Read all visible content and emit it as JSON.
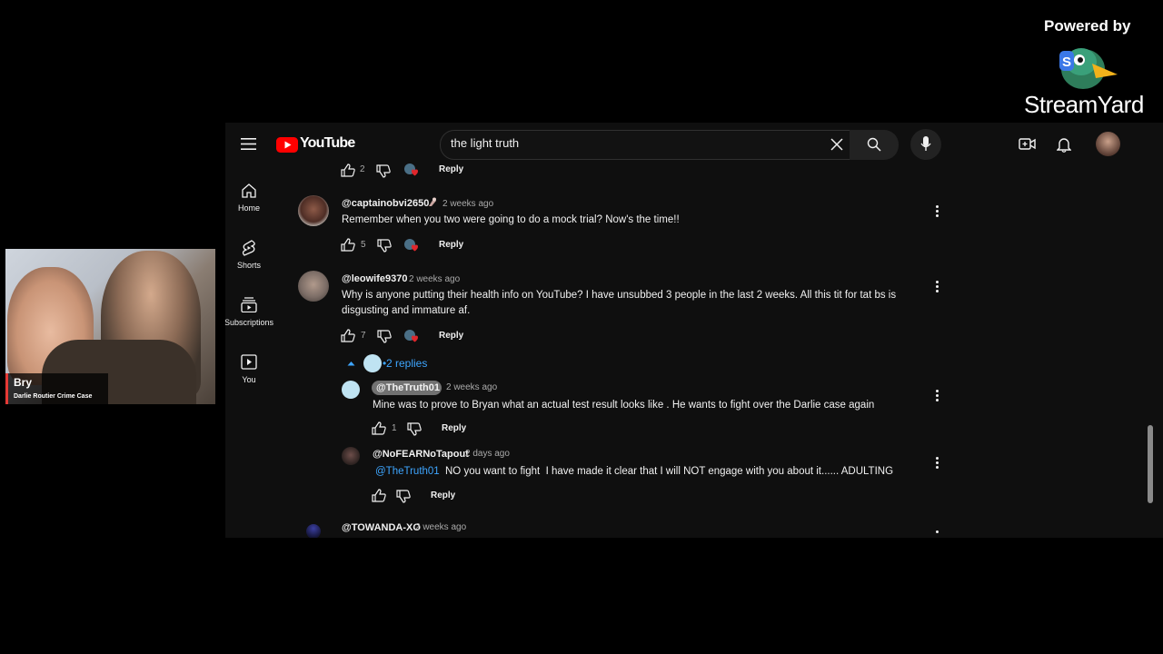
{
  "youtube": {
    "logo_text": "YouTube",
    "search_value": "the light truth",
    "sidebar": [
      {
        "label": "Home",
        "icon": "home-icon"
      },
      {
        "label": "Shorts",
        "icon": "shorts-icon"
      },
      {
        "label": "Subscriptions",
        "icon": "subscriptions-icon"
      },
      {
        "label": "You",
        "icon": "you-icon"
      }
    ],
    "comments": {
      "prev_actions": {
        "likes": "2",
        "reply": "Reply"
      },
      "items": [
        {
          "handle": "@captainobvi2650",
          "time": "2 weeks ago",
          "text": "Remember when you two were going to do a mock trial? Now's the time!!",
          "likes": "5",
          "reply": "Reply"
        },
        {
          "handle": "@leowife9370",
          "time": "2 weeks ago",
          "text_line1": "Why is anyone putting their health info on YouTube? I have unsubbed 3 people in the last 2 weeks. All this tit for tat bs is",
          "text_line2": "disgusting and immature af.",
          "likes": "7",
          "reply": "Reply"
        }
      ],
      "replies_toggle": "2 replies",
      "replies": [
        {
          "handle": "@TheTruth01",
          "time": "2 weeks ago",
          "text": "Mine was to prove to Bryan what an actual test result looks like . He wants to fight over the Darlie case again",
          "likes": "1",
          "reply": "Reply"
        },
        {
          "handle": "@NoFEARNoTapout",
          "time": "2 days ago",
          "mention": "@TheTruth01",
          "text": "NO you want to fight  I have made it clear that I will NOT engage with you about it...... ADULTING",
          "likes": "",
          "reply": "Reply"
        }
      ],
      "next": {
        "handle": "@TOWANDA-XO",
        "time": "2 weeks ago"
      }
    }
  },
  "overlay": {
    "powered_by": "Powered by",
    "brand": "StreamYard",
    "camera_name": "Bry",
    "camera_subtitle": "Darlie Routier Crime Case"
  },
  "colors": {
    "youtube_red": "#ff0000",
    "link_blue": "#3ea6ff",
    "background": "#0f0f0f",
    "camera_accent": "#e53935"
  }
}
